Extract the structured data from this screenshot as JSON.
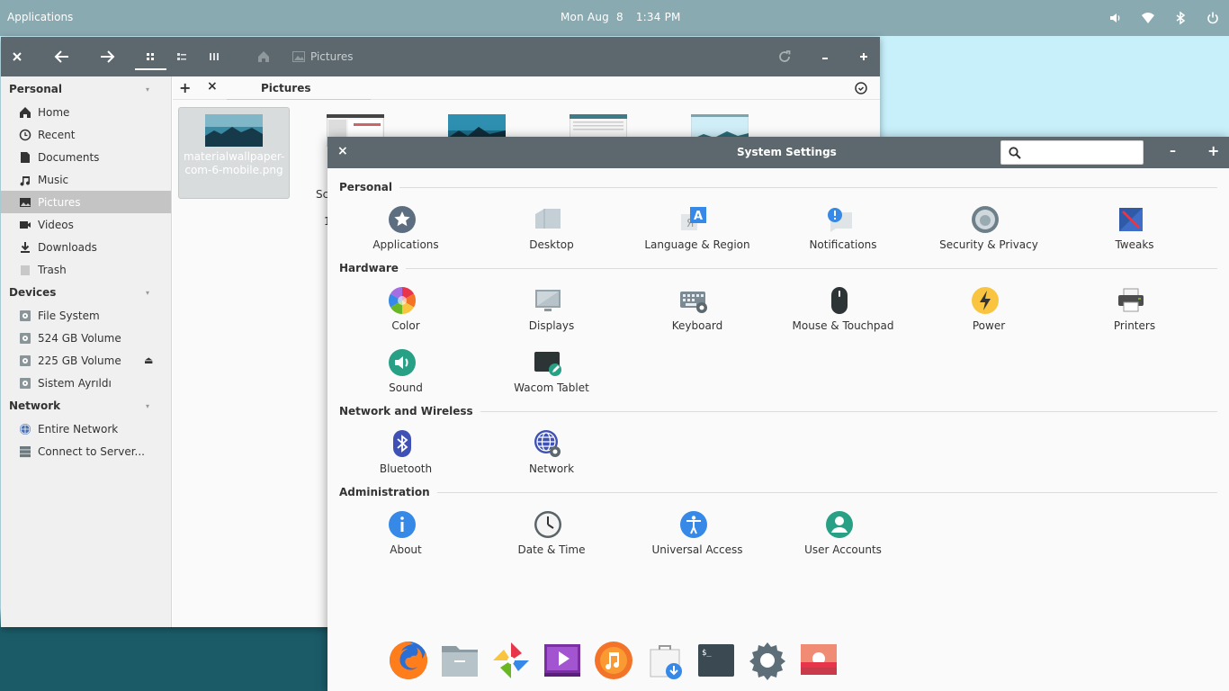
{
  "panel": {
    "applications_label": "Applications",
    "date": "Mon Aug  8",
    "time": "1:34 PM",
    "indicators": [
      "volume-icon",
      "wifi-icon",
      "bluetooth-icon",
      "power-icon"
    ]
  },
  "files": {
    "breadcrumb_label": "Pictures",
    "tab_label": "Pictures",
    "sidebar": {
      "personal_label": "Personal",
      "personal_items": [
        {
          "label": "Home",
          "icon": "home-icon"
        },
        {
          "label": "Recent",
          "icon": "clock-icon"
        },
        {
          "label": "Documents",
          "icon": "document-icon"
        },
        {
          "label": "Music",
          "icon": "music-icon"
        },
        {
          "label": "Pictures",
          "icon": "pictures-icon"
        },
        {
          "label": "Videos",
          "icon": "video-icon"
        },
        {
          "label": "Downloads",
          "icon": "download-icon"
        },
        {
          "label": "Trash",
          "icon": "trash-icon"
        }
      ],
      "devices_label": "Devices",
      "device_items": [
        {
          "label": "File System",
          "icon": "drive-icon"
        },
        {
          "label": "524 GB Volume",
          "icon": "drive-icon"
        },
        {
          "label": "225 GB Volume",
          "icon": "drive-icon"
        },
        {
          "label": "Sistem Ayrıldı",
          "icon": "drive-icon"
        }
      ],
      "network_label": "Network",
      "network_items": [
        {
          "label": "Entire Network",
          "icon": "globe-icon"
        },
        {
          "label": "Connect to Server...",
          "icon": "server-icon"
        }
      ]
    },
    "file_name_selected": "materialwallpaper-com-6-mobile.png",
    "file_name_line1": "materialwallpaper-",
    "file_name_line2": "com-6-mobile.png",
    "file_name_partial_a": "Sc",
    "file_name_partial_b": "1"
  },
  "settings": {
    "title": "System Settings",
    "search_placeholder": "",
    "categories": {
      "personal": {
        "label": "Personal",
        "items": [
          {
            "label": "Applications",
            "icon": "applications-icon"
          },
          {
            "label": "Desktop",
            "icon": "desktop-icon"
          },
          {
            "label": "Language & Region",
            "icon": "language-icon"
          },
          {
            "label": "Notifications",
            "icon": "notifications-icon"
          },
          {
            "label": "Security & Privacy",
            "icon": "security-icon"
          },
          {
            "label": "Tweaks",
            "icon": "tweaks-icon"
          }
        ]
      },
      "hardware": {
        "label": "Hardware",
        "items": [
          {
            "label": "Color",
            "icon": "color-icon"
          },
          {
            "label": "Displays",
            "icon": "displays-icon"
          },
          {
            "label": "Keyboard",
            "icon": "keyboard-icon"
          },
          {
            "label": "Mouse & Touchpad",
            "icon": "mouse-icon"
          },
          {
            "label": "Power",
            "icon": "power-icon"
          },
          {
            "label": "Printers",
            "icon": "printer-icon"
          },
          {
            "label": "Sound",
            "icon": "sound-icon"
          },
          {
            "label": "Wacom Tablet",
            "icon": "tablet-icon"
          }
        ]
      },
      "network": {
        "label": "Network and Wireless",
        "items": [
          {
            "label": "Bluetooth",
            "icon": "bluetooth-icon"
          },
          {
            "label": "Network",
            "icon": "network-icon"
          }
        ]
      },
      "admin": {
        "label": "Administration",
        "items": [
          {
            "label": "About",
            "icon": "about-icon"
          },
          {
            "label": "Date & Time",
            "icon": "clock-icon"
          },
          {
            "label": "Universal Access",
            "icon": "accessibility-icon"
          },
          {
            "label": "User Accounts",
            "icon": "user-icon"
          }
        ]
      }
    }
  },
  "dock": {
    "apps": [
      "firefox-icon",
      "files-icon",
      "photos-icon",
      "videos-icon",
      "music-icon",
      "appcenter-icon",
      "terminal-icon",
      "settings-icon",
      "image-viewer-icon"
    ]
  },
  "colors": {
    "panel": "#8aaab2",
    "titlebar": "#5c686d",
    "wallpaper": "#c8f0fb",
    "accent_blue": "#3689e6"
  }
}
